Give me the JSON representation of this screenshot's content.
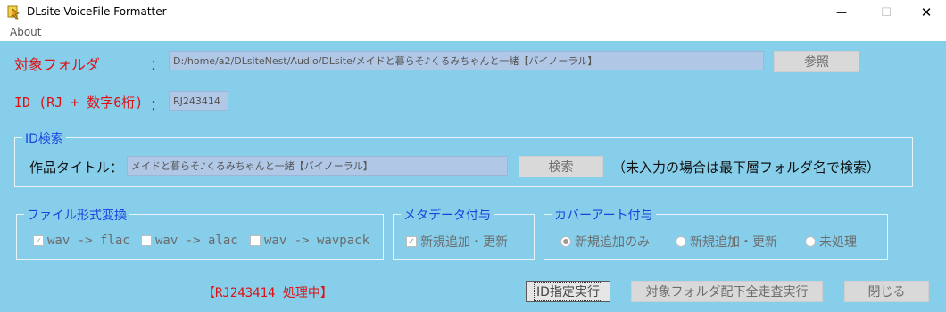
{
  "window": {
    "title": "DLsite VoiceFile Formatter",
    "minimize_icon": "—",
    "maximize_icon": "☐",
    "close_icon": "✕"
  },
  "menu": {
    "about": "About"
  },
  "target_folder": {
    "label": "対象フォルダ",
    "colon": "：",
    "value": "D:/home/a2/DLsiteNest/Audio/DLsite/メイドと暮らそ♪くるみちゃんと一緒【バイノーラル】",
    "browse_label": "参照"
  },
  "id_field": {
    "label": "ID (RJ + 数字6桁)",
    "colon": "：",
    "value": "RJ243414"
  },
  "id_search": {
    "legend": "ID検索",
    "title_label": "作品タイトル：",
    "title_value": "メイドと暮らそ♪くるみちゃんと一緒【バイノーラル】",
    "search_label": "検索",
    "note": "（未入力の場合は最下層フォルダ名で検索）"
  },
  "file_conversion": {
    "legend": "ファイル形式変換",
    "options": [
      {
        "label": "wav -> flac",
        "checked": true
      },
      {
        "label": "wav -> alac",
        "checked": false
      },
      {
        "label": "wav -> wavpack",
        "checked": false
      }
    ]
  },
  "metadata": {
    "legend": "メタデータ付与",
    "option": {
      "label": "新規追加・更新",
      "checked": true
    }
  },
  "cover_art": {
    "legend": "カバーアート付与",
    "options": [
      {
        "label": "新規追加のみ",
        "selected": true
      },
      {
        "label": "新規追加・更新",
        "selected": false
      },
      {
        "label": "未処理",
        "selected": false
      }
    ]
  },
  "status": "【RJ243414 処理中】",
  "actions": {
    "run_id": "ID指定実行",
    "run_all": "対象フォルダ配下全走査実行",
    "close": "閉じる"
  },
  "colors": {
    "client_bg": "#87CEEB",
    "label_red": "#dd1111",
    "label_blue": "#1a44dd"
  }
}
